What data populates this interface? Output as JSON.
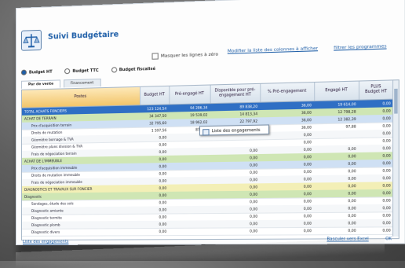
{
  "app": {
    "title": "Suivi Budgétaire"
  },
  "options": {
    "mask_zero_label": "Masquer les lignes à zéro",
    "modify_columns_link": "Modifier la liste des colonnes à afficher",
    "filter_link": "filtrer les programmes"
  },
  "radios": [
    {
      "label": "Budget HT",
      "selected": true
    },
    {
      "label": "Budget TTC",
      "selected": false
    },
    {
      "label": "Budget fiscalisé",
      "selected": false
    }
  ],
  "tabs": [
    {
      "label": "Par de vente",
      "active": true
    },
    {
      "label": "Financement",
      "active": false
    }
  ],
  "columns": {
    "postes": "Postes",
    "budget_ht": "Budget HT",
    "pre_engage": "Pré-engagé HT",
    "disponible": "Disponible pour pré-engagement HT",
    "pct_pre": "% Pré-engagement",
    "engage": "Engagé HT",
    "plus": "PLUS",
    "budget_ht2": "Budget HT"
  },
  "rows": [
    {
      "label": "TOTAL ACHATS FONCIERS",
      "budget": "123 124,54",
      "pre": "94 286,34",
      "dispo": "89 838,20",
      "pct": "36,00",
      "engage": "19 614,00",
      "last": "0,00",
      "style": "sel"
    },
    {
      "label": "ACHAT DE TERRAIN",
      "budget": "34 347,50",
      "pre": "19 539,02",
      "dispo": "14 813,34",
      "pct": "36,00",
      "engage": "12 798,28",
      "last": "0,00",
      "style": "green"
    },
    {
      "label": "Prix d'acquisition terrain",
      "budget": "32 795,60",
      "pre": "18 962,02",
      "dispo": "22 797,92",
      "pct": "36,00",
      "engage": "12 382,39",
      "last": "0,00",
      "style": "blue"
    },
    {
      "label": "Droits de mutation",
      "budget": "1 597,56",
      "pre": "876,00",
      "dispo": "",
      "pct": "36,00",
      "engage": "97,88",
      "last": "0,00",
      "style": ""
    },
    {
      "label": "Géomètre bornage & TVA",
      "budget": "0,00",
      "pre": "",
      "dispo": "",
      "pct": "0,00",
      "engage": "",
      "last": "0,00",
      "style": "alt"
    },
    {
      "label": "Géomètre plans division & TVA",
      "budget": "0,00",
      "pre": "",
      "dispo": "",
      "pct": "0,00",
      "engage": "",
      "last": "0,00",
      "style": ""
    },
    {
      "label": "Frais de négociation terrain",
      "budget": "0,00",
      "pre": "",
      "dispo": "0,00",
      "pct": "0,00",
      "engage": "0,00",
      "last": "0,00",
      "style": "alt"
    },
    {
      "label": "ACHAT DE L'IMMEUBLE",
      "budget": "0,00",
      "pre": "",
      "dispo": "0,00",
      "pct": "0,00",
      "engage": "0,00",
      "last": "0,00",
      "style": "green"
    },
    {
      "label": "Prix d'acquisition immeuble",
      "budget": "0,00",
      "pre": "",
      "dispo": "0,00",
      "pct": "0,00",
      "engage": "0,00",
      "last": "0,00",
      "style": "blue"
    },
    {
      "label": "Droits de mutation immeuble",
      "budget": "0,00",
      "pre": "",
      "dispo": "0,00",
      "pct": "0,00",
      "engage": "0,00",
      "last": "0,00",
      "style": ""
    },
    {
      "label": "Frais de négociation immeuble",
      "budget": "0,00",
      "pre": "",
      "dispo": "0,00",
      "pct": "0,00",
      "engage": "0,00",
      "last": "0,00",
      "style": "alt"
    },
    {
      "label": "DIAGNOSTICS ET TRAVAUX SUR FONCIER",
      "budget": "0,00",
      "pre": "",
      "dispo": "0,00",
      "pct": "0,00",
      "engage": "0,00",
      "last": "0,00",
      "style": "yellow"
    },
    {
      "label": "Diagnostic",
      "budget": "0,00",
      "pre": "",
      "dispo": "0,00",
      "pct": "0,00",
      "engage": "0,00",
      "last": "0,00",
      "style": "green"
    },
    {
      "label": "Sondages, étude des sols",
      "budget": "0,00",
      "pre": "",
      "dispo": "0,00",
      "pct": "0,00",
      "engage": "0,00",
      "last": "0,00",
      "style": ""
    },
    {
      "label": "Diagnostic amiante",
      "budget": "0,00",
      "pre": "",
      "dispo": "0,00",
      "pct": "0,00",
      "engage": "0,00",
      "last": "0,00",
      "style": "alt"
    },
    {
      "label": "Diagnostic termite",
      "budget": "0,00",
      "pre": "",
      "dispo": "0,00",
      "pct": "0,00",
      "engage": "0,00",
      "last": "0,00",
      "style": ""
    },
    {
      "label": "Diagnostic plomb",
      "budget": "0,00",
      "pre": "",
      "dispo": "0,00",
      "pct": "0,00",
      "engage": "0,00",
      "last": "0,00",
      "style": "alt"
    },
    {
      "label": "Diagnostic divers",
      "budget": "0,00",
      "pre": "",
      "dispo": "0,00",
      "pct": "0,00",
      "engage": "0,00",
      "last": "0,00",
      "style": ""
    }
  ],
  "context_menu": {
    "item": "Liste des engagements"
  },
  "footer": {
    "link_left": "Liste des engagements",
    "link_right": "Basculer vers Excel",
    "ok": "OK"
  }
}
